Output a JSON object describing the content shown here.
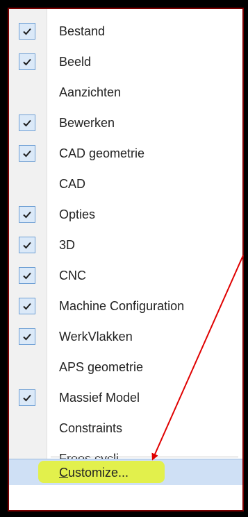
{
  "menu": {
    "items": [
      {
        "label": "Bestand",
        "checked": true
      },
      {
        "label": "Beeld",
        "checked": true
      },
      {
        "label": "Aanzichten",
        "checked": false
      },
      {
        "label": "Bewerken",
        "checked": true
      },
      {
        "label": "CAD geometrie",
        "checked": true
      },
      {
        "label": "CAD",
        "checked": false
      },
      {
        "label": "Opties",
        "checked": true
      },
      {
        "label": "3D",
        "checked": true
      },
      {
        "label": "CNC",
        "checked": true
      },
      {
        "label": "Machine Configuration",
        "checked": true
      },
      {
        "label": "WerkVlakken",
        "checked": true
      },
      {
        "label": "APS geometrie",
        "checked": false
      },
      {
        "label": "Massief Model",
        "checked": true
      },
      {
        "label": "Constraints",
        "checked": false
      },
      {
        "label": "Frees cycli",
        "checked": false
      }
    ],
    "customize": {
      "mnemonic": "C",
      "rest": "ustomize..."
    }
  },
  "colors": {
    "checkbox_fill": "#dbe9f8",
    "checkbox_border": "#6e9fd4",
    "annotation_arrow": "#e00000",
    "highlight": "#e3f23a",
    "selected_row": "#cfe0f5"
  },
  "icons": {
    "check": "check-icon"
  }
}
